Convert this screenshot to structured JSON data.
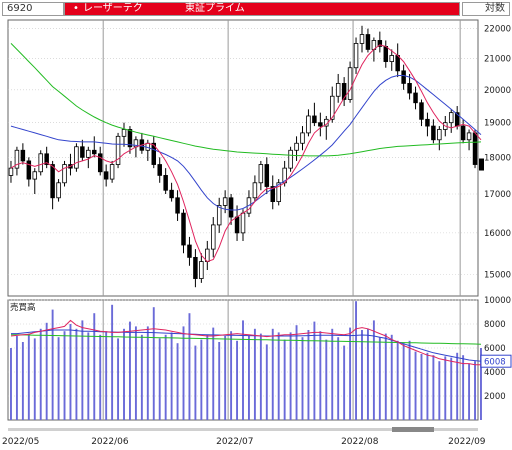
{
  "header": {
    "code": "6920",
    "bullet": "•",
    "name": "レーザーテク",
    "market": "東証プライム",
    "scale_label": "対数"
  },
  "colors": {
    "up_candle": "#ffffff",
    "down_candle": "#000000",
    "ma_short": "#e0245e",
    "ma_mid": "#3344cc",
    "ma_long": "#22bb22",
    "volume_bar": "#6a6ad8",
    "grid": "#c8c8c8",
    "panel_border": "#666666"
  },
  "chart_data": [
    {
      "type": "candlestick",
      "title": "",
      "scale": "log",
      "ylim": [
        14500,
        22300
      ],
      "yticks": [
        15000,
        16000,
        17000,
        18000,
        19000,
        20000,
        21000,
        22000
      ],
      "ytick_labels": [
        "15000",
        "16000",
        "17000",
        "18000",
        "19000",
        "20000",
        "21000",
        "22000"
      ],
      "x_labels": [
        "2022/05",
        "2022/06",
        "2022/07",
        "2022/08",
        "2022/09"
      ],
      "grid": true,
      "last_price_label": "",
      "ohlc": [
        [
          17500,
          17900,
          17300,
          17700
        ],
        [
          17700,
          18300,
          17500,
          18200
        ],
        [
          18200,
          18400,
          17800,
          17900
        ],
        [
          17900,
          18000,
          17200,
          17400
        ],
        [
          17400,
          17700,
          17000,
          17600
        ],
        [
          17600,
          18200,
          17500,
          18100
        ],
        [
          18100,
          18300,
          17700,
          17800
        ],
        [
          17800,
          17900,
          16600,
          16900
        ],
        [
          16900,
          17400,
          16800,
          17300
        ],
        [
          17300,
          17900,
          17200,
          17800
        ],
        [
          17800,
          18100,
          17500,
          17700
        ],
        [
          17700,
          18400,
          17600,
          18300
        ],
        [
          18300,
          18500,
          17900,
          18000
        ],
        [
          18000,
          18300,
          17700,
          18200
        ],
        [
          18200,
          18600,
          18000,
          18100
        ],
        [
          18100,
          18300,
          17500,
          17600
        ],
        [
          17600,
          17800,
          17200,
          17400
        ],
        [
          17400,
          17900,
          17300,
          17800
        ],
        [
          17800,
          18700,
          17700,
          18600
        ],
        [
          18600,
          19000,
          18300,
          18800
        ],
        [
          18800,
          18900,
          18100,
          18300
        ],
        [
          18300,
          18600,
          18000,
          18500
        ],
        [
          18500,
          18700,
          18100,
          18200
        ],
        [
          18200,
          18500,
          17900,
          18400
        ],
        [
          18400,
          18600,
          17700,
          17800
        ],
        [
          17800,
          18000,
          17300,
          17500
        ],
        [
          17500,
          17700,
          17000,
          17100
        ],
        [
          17100,
          17300,
          16800,
          16900
        ],
        [
          16900,
          17100,
          16300,
          16500
        ],
        [
          16500,
          16600,
          15500,
          15700
        ],
        [
          15700,
          15900,
          15200,
          15400
        ],
        [
          15400,
          15600,
          14700,
          14900
        ],
        [
          14900,
          15500,
          14800,
          15300
        ],
        [
          15300,
          15800,
          15100,
          15600
        ],
        [
          15600,
          16400,
          15400,
          16200
        ],
        [
          16200,
          16900,
          16000,
          16700
        ],
        [
          16700,
          17100,
          16500,
          16900
        ],
        [
          16900,
          17000,
          16200,
          16400
        ],
        [
          16400,
          16700,
          15800,
          16000
        ],
        [
          16000,
          16600,
          15800,
          16500
        ],
        [
          16500,
          17100,
          16400,
          16900
        ],
        [
          16900,
          17500,
          16800,
          17300
        ],
        [
          17300,
          17900,
          17100,
          17800
        ],
        [
          17800,
          18000,
          17000,
          17200
        ],
        [
          17200,
          17500,
          16600,
          16800
        ],
        [
          16800,
          17400,
          16700,
          17300
        ],
        [
          17300,
          17900,
          17200,
          17700
        ],
        [
          17700,
          18300,
          17600,
          18200
        ],
        [
          18200,
          18600,
          17900,
          18400
        ],
        [
          18400,
          18900,
          18200,
          18700
        ],
        [
          18700,
          19400,
          18600,
          19200
        ],
        [
          19200,
          19600,
          18900,
          19000
        ],
        [
          19000,
          19300,
          18600,
          18900
        ],
        [
          18900,
          19200,
          18500,
          19100
        ],
        [
          19100,
          20100,
          19000,
          19800
        ],
        [
          19800,
          20500,
          19600,
          20200
        ],
        [
          20200,
          20400,
          19500,
          19700
        ],
        [
          19700,
          20900,
          19600,
          20700
        ],
        [
          20700,
          21700,
          20500,
          21500
        ],
        [
          21500,
          22100,
          21200,
          21800
        ],
        [
          21800,
          22000,
          21200,
          21300
        ],
        [
          21300,
          21700,
          20900,
          21600
        ],
        [
          21600,
          21900,
          21200,
          21400
        ],
        [
          21400,
          21600,
          20700,
          20900
        ],
        [
          20900,
          21300,
          20600,
          21100
        ],
        [
          21100,
          21500,
          20400,
          20600
        ],
        [
          20600,
          20800,
          20000,
          20200
        ],
        [
          20200,
          20500,
          19700,
          19900
        ],
        [
          19900,
          20100,
          19400,
          19600
        ],
        [
          19600,
          19700,
          18900,
          19100
        ],
        [
          19100,
          19300,
          18600,
          18900
        ],
        [
          18900,
          19100,
          18400,
          18500
        ],
        [
          18500,
          18900,
          18200,
          18800
        ],
        [
          18800,
          19200,
          18600,
          19000
        ],
        [
          19000,
          19400,
          18700,
          19300
        ],
        [
          19300,
          19500,
          18800,
          18900
        ],
        [
          18900,
          19100,
          18400,
          18500
        ],
        [
          18500,
          18800,
          18200,
          18700
        ],
        [
          18700,
          18800,
          17700,
          17800
        ]
      ],
      "ma_short": [
        17700,
        17800,
        17850,
        17800,
        17750,
        17800,
        17850,
        17750,
        17600,
        17700,
        17750,
        17850,
        17900,
        17950,
        18050,
        18000,
        17900,
        17850,
        17950,
        18100,
        18200,
        18300,
        18350,
        18400,
        18350,
        18150,
        17900,
        17600,
        17250,
        16800,
        16300,
        15800,
        15450,
        15300,
        15350,
        15650,
        16050,
        16300,
        16400,
        16500,
        16600,
        16800,
        17000,
        17150,
        17150,
        17200,
        17300,
        17500,
        17750,
        18050,
        18400,
        18700,
        18850,
        18950,
        19150,
        19450,
        19750,
        20000,
        20400,
        20800,
        21100,
        21300,
        21450,
        21400,
        21250,
        21100,
        20900,
        20600,
        20300,
        19950,
        19600,
        19300,
        19050,
        18900,
        18850,
        18900,
        18950,
        18900,
        18700,
        18500
      ],
      "ma_mid": [
        18900,
        18850,
        18800,
        18750,
        18700,
        18650,
        18600,
        18550,
        18500,
        18480,
        18460,
        18450,
        18440,
        18440,
        18440,
        18420,
        18400,
        18380,
        18370,
        18370,
        18360,
        18340,
        18320,
        18280,
        18220,
        18150,
        18080,
        18000,
        17900,
        17750,
        17550,
        17330,
        17100,
        16900,
        16750,
        16650,
        16600,
        16580,
        16580,
        16620,
        16700,
        16800,
        16920,
        17040,
        17150,
        17250,
        17350,
        17450,
        17560,
        17680,
        17800,
        17930,
        18060,
        18200,
        18350,
        18550,
        18750,
        18950,
        19200,
        19450,
        19700,
        19950,
        20150,
        20300,
        20400,
        20450,
        20450,
        20400,
        20300,
        20150,
        20000,
        19850,
        19700,
        19550,
        19400,
        19250,
        19100,
        18950,
        18800,
        18650
      ],
      "ma_long": [
        21500,
        21300,
        21100,
        20900,
        20700,
        20500,
        20300,
        20100,
        19950,
        19800,
        19650,
        19500,
        19380,
        19270,
        19170,
        19080,
        19000,
        18930,
        18870,
        18820,
        18770,
        18720,
        18680,
        18640,
        18600,
        18560,
        18520,
        18480,
        18440,
        18400,
        18360,
        18320,
        18290,
        18260,
        18230,
        18210,
        18190,
        18170,
        18150,
        18140,
        18130,
        18120,
        18110,
        18100,
        18090,
        18080,
        18070,
        18060,
        18050,
        18050,
        18040,
        18040,
        18040,
        18040,
        18050,
        18060,
        18080,
        18100,
        18130,
        18160,
        18190,
        18220,
        18250,
        18270,
        18290,
        18310,
        18320,
        18330,
        18340,
        18350,
        18360,
        18370,
        18380,
        18390,
        18400,
        18410,
        18420,
        18430,
        18430,
        18440
      ]
    },
    {
      "type": "bar",
      "title": "売買高",
      "ylim": [
        0,
        10000
      ],
      "yticks": [
        2000,
        4000,
        6000,
        8000,
        10000
      ],
      "ytick_labels": [
        "2000",
        "4000",
        "6000",
        "8000",
        "10000"
      ],
      "last_value_label": "6008",
      "values": [
        6000,
        7000,
        6500,
        7200,
        6800,
        7600,
        8100,
        9200,
        6900,
        7400,
        8000,
        7600,
        8300,
        7300,
        8900,
        7100,
        7400,
        9600,
        6800,
        7600,
        8200,
        7800,
        7100,
        7800,
        9400,
        6800,
        7100,
        7300,
        6400,
        7800,
        8900,
        6200,
        6700,
        7100,
        7700,
        6500,
        7000,
        7400,
        6600,
        8300,
        7000,
        7600,
        7200,
        6300,
        7600,
        7300,
        6700,
        7300,
        7900,
        6900,
        7500,
        8200,
        7400,
        6700,
        7600,
        6900,
        6200,
        7700,
        9900,
        7500,
        7600,
        8300,
        6900,
        7200,
        7100,
        6600,
        6400,
        6600,
        5700,
        5500,
        5600,
        5400,
        4900,
        5300,
        5200,
        5600,
        5400,
        4700,
        4900,
        6000
      ],
      "vol_ma_short": [
        7000,
        7050,
        7100,
        7150,
        7300,
        7400,
        7500,
        7600,
        7700,
        7800,
        8300,
        7900,
        7700,
        7600,
        7500,
        7400,
        7350,
        7300,
        7300,
        7350,
        7400,
        7450,
        7500,
        7550,
        7600,
        7550,
        7500,
        7400,
        7300,
        7200,
        7150,
        7100,
        7050,
        7000,
        7000,
        7050,
        7100,
        7150,
        7200,
        7150,
        7100,
        7050,
        7000,
        6950,
        7000,
        7050,
        7100,
        7100,
        7150,
        7200,
        7250,
        7300,
        7300,
        7250,
        7200,
        7150,
        7100,
        7200,
        7600,
        7700,
        7600,
        7400,
        7200,
        7000,
        6700,
        6500,
        6200,
        6000,
        5800,
        5600,
        5400,
        5300,
        5100,
        5000,
        4900,
        4800,
        4700,
        4700,
        4600,
        4600
      ],
      "vol_ma_mid": [
        7200,
        7200,
        7250,
        7300,
        7350,
        7400,
        7450,
        7500,
        7500,
        7500,
        7500,
        7450,
        7400,
        7400,
        7380,
        7360,
        7340,
        7330,
        7320,
        7310,
        7300,
        7300,
        7300,
        7290,
        7280,
        7260,
        7240,
        7220,
        7200,
        7180,
        7160,
        7140,
        7120,
        7100,
        7090,
        7080,
        7070,
        7060,
        7050,
        7040,
        7030,
        7020,
        7010,
        7000,
        7000,
        7000,
        7000,
        7000,
        7010,
        7020,
        7030,
        7050,
        7060,
        7060,
        7060,
        7050,
        7040,
        7030,
        7050,
        7080,
        7060,
        7000,
        6900,
        6800,
        6650,
        6500,
        6350,
        6200,
        6050,
        5900,
        5750,
        5600,
        5500,
        5400,
        5300,
        5200,
        5100,
        5000,
        4950,
        4900
      ],
      "vol_ma_long": [
        7100,
        7100,
        7090,
        7080,
        7070,
        7060,
        7050,
        7040,
        7030,
        7020,
        7010,
        7000,
        6990,
        6980,
        6970,
        6960,
        6950,
        6940,
        6930,
        6920,
        6910,
        6900,
        6890,
        6880,
        6870,
        6860,
        6850,
        6840,
        6830,
        6820,
        6810,
        6800,
        6790,
        6780,
        6770,
        6760,
        6750,
        6740,
        6730,
        6720,
        6710,
        6700,
        6690,
        6680,
        6670,
        6660,
        6650,
        6640,
        6630,
        6620,
        6610,
        6600,
        6590,
        6580,
        6570,
        6560,
        6550,
        6540,
        6530,
        6520,
        6510,
        6500,
        6490,
        6480,
        6470,
        6460,
        6450,
        6440,
        6430,
        6420,
        6410,
        6400,
        6390,
        6380,
        6370,
        6360,
        6350,
        6340,
        6330,
        6320
      ]
    }
  ]
}
